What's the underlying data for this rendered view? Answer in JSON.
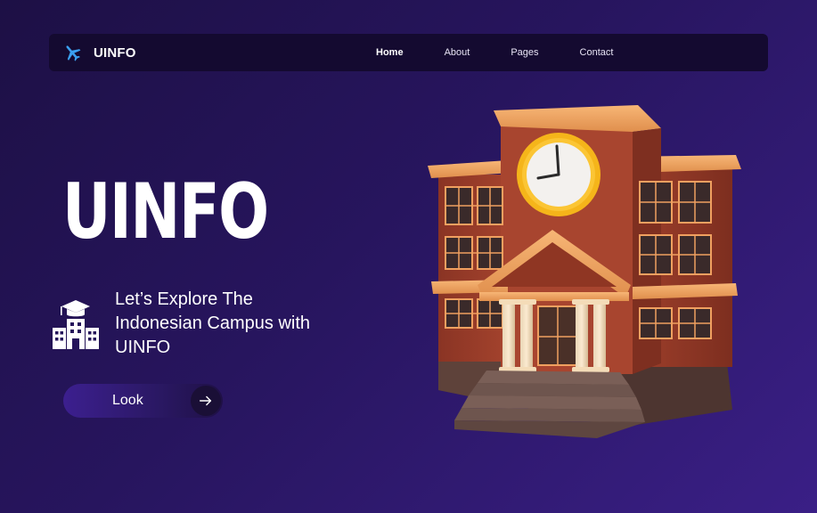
{
  "nav": {
    "brand": "UINFO",
    "brand_icon": "airplane-icon",
    "links": [
      {
        "label": "Home",
        "active": true
      },
      {
        "label": "About",
        "active": false
      },
      {
        "label": "Pages",
        "active": false
      },
      {
        "label": "Contact",
        "active": false
      }
    ]
  },
  "hero": {
    "title": "UINFO",
    "tagline": "Let’s Explore The Indonesian Campus with UINFO",
    "tagline_icon": "campus-building-icon",
    "button_label": "Look",
    "button_icon": "arrow-right-icon",
    "illustration": "school-building-illustration"
  },
  "colors": {
    "background_start": "#1d1045",
    "background_end": "#3a1f86",
    "nav_background": "#140a30",
    "brand_icon": "#3aa0f0",
    "building_wall": "#a1402b",
    "building_trim": "#f2a868",
    "clock_rim": "#f5b51a"
  }
}
